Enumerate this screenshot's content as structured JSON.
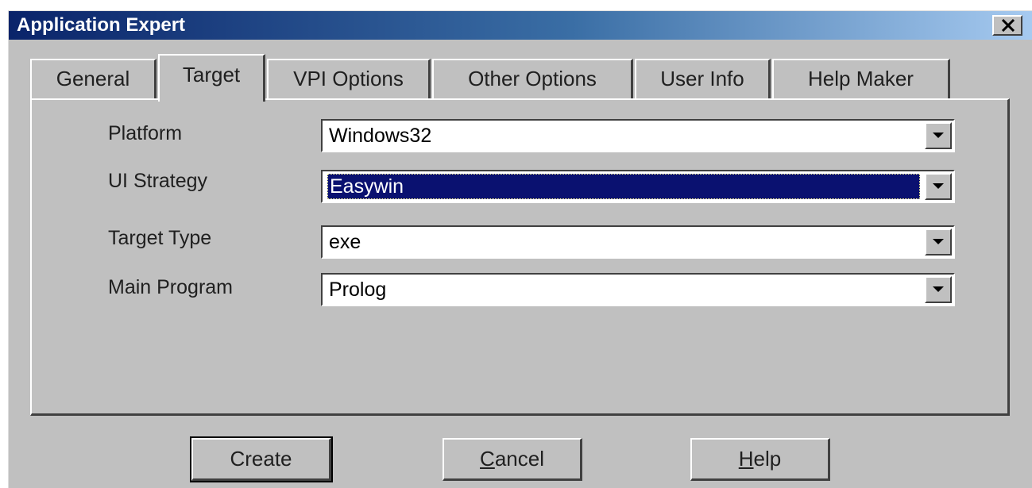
{
  "window": {
    "title": "Application Expert"
  },
  "tabs": [
    {
      "label": "General",
      "active": false
    },
    {
      "label": "Target",
      "active": true
    },
    {
      "label": "VPI Options",
      "active": false
    },
    {
      "label": "Other Options",
      "active": false
    },
    {
      "label": "User Info",
      "active": false
    },
    {
      "label": "Help Maker",
      "active": false
    }
  ],
  "fields": {
    "platform": {
      "label": "Platform",
      "value": "Windows32"
    },
    "ui_strategy": {
      "label": "UI Strategy",
      "value": "Easywin"
    },
    "target_type": {
      "label": "Target Type",
      "value": "exe"
    },
    "main_program": {
      "label": "Main Program",
      "value": "Prolog"
    }
  },
  "buttons": {
    "create": "Create",
    "cancel_mnemonic": "C",
    "cancel_rest": "ancel",
    "help_mnemonic": "H",
    "help_rest": "elp"
  },
  "colors": {
    "face": "#c0c0c0",
    "titlebar_start": "#0a246a",
    "selection": "#0a1170"
  },
  "icons": [
    "close-icon",
    "dropdown-arrow-icon"
  ]
}
